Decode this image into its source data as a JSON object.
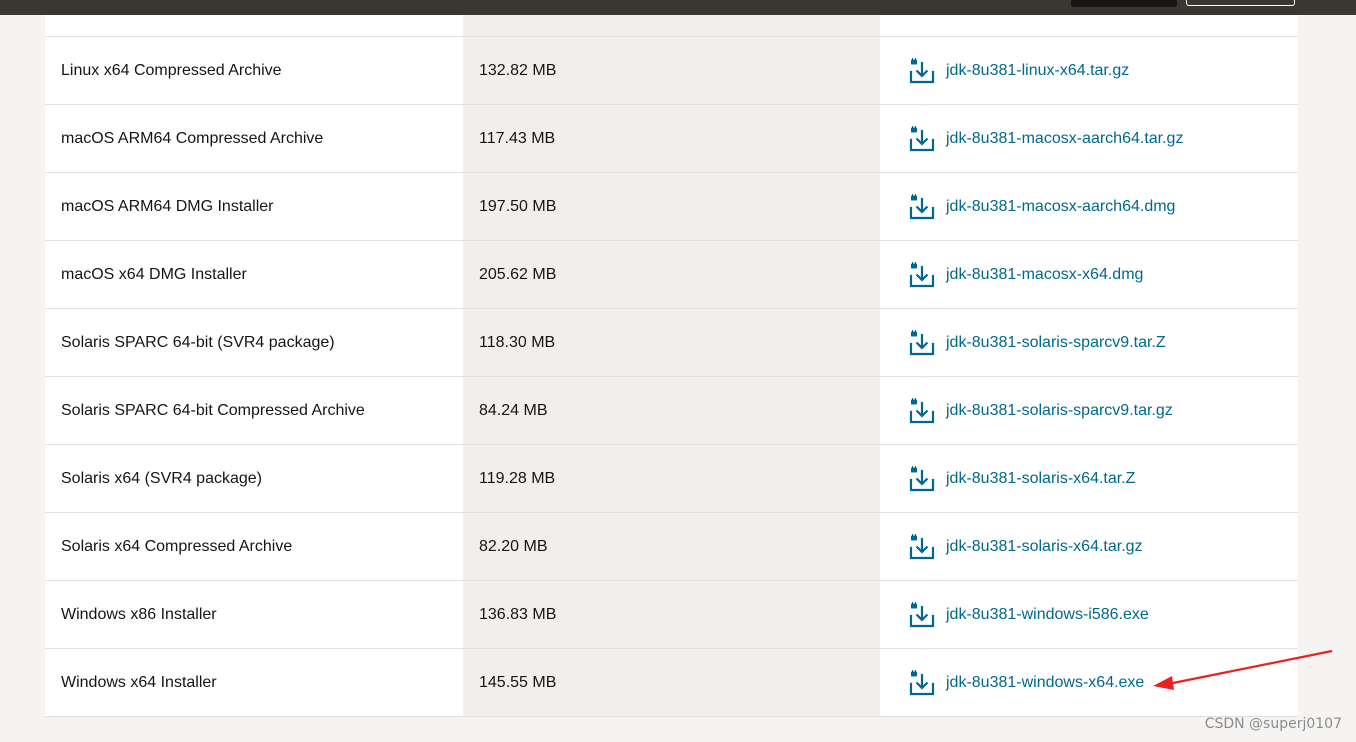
{
  "downloads": [
    {
      "description": "Linux x64 Compressed Archive",
      "size": "132.82 MB",
      "file": "jdk-8u381-linux-x64.tar.gz",
      "icon": "download-icon"
    },
    {
      "description": "macOS ARM64 Compressed Archive",
      "size": "117.43 MB",
      "file": "jdk-8u381-macosx-aarch64.tar.gz",
      "icon": "download-icon"
    },
    {
      "description": "macOS ARM64 DMG Installer",
      "size": "197.50 MB",
      "file": "jdk-8u381-macosx-aarch64.dmg",
      "icon": "download-icon"
    },
    {
      "description": "macOS x64 DMG Installer",
      "size": "205.62 MB",
      "file": "jdk-8u381-macosx-x64.dmg",
      "icon": "download-icon"
    },
    {
      "description": "Solaris SPARC 64-bit (SVR4 package)",
      "size": "118.30 MB",
      "file": "jdk-8u381-solaris-sparcv9.tar.Z",
      "icon": "download-icon"
    },
    {
      "description": "Solaris SPARC 64-bit Compressed Archive",
      "size": "84.24 MB",
      "file": "jdk-8u381-solaris-sparcv9.tar.gz",
      "icon": "download-icon"
    },
    {
      "description": "Solaris x64 (SVR4 package)",
      "size": "119.28 MB",
      "file": "jdk-8u381-solaris-x64.tar.Z",
      "icon": "download-icon"
    },
    {
      "description": "Solaris x64 Compressed Archive",
      "size": "82.20 MB",
      "file": "jdk-8u381-solaris-x64.tar.gz",
      "icon": "download-icon"
    },
    {
      "description": "Windows x86 Installer",
      "size": "136.83 MB",
      "file": "jdk-8u381-windows-i586.exe",
      "icon": "download-icon"
    },
    {
      "description": "Windows x64 Installer",
      "size": "145.55 MB",
      "file": "jdk-8u381-windows-x64.exe",
      "icon": "download-icon"
    }
  ],
  "annotation": {
    "arrow_color": "#e8231f",
    "target": "jdk-8u381-windows-x64.exe"
  },
  "watermark": "CSDN @superj0107",
  "colors": {
    "link": "#00688c",
    "size_column_bg": "#f0efed",
    "top_bar": "#3a3632"
  }
}
